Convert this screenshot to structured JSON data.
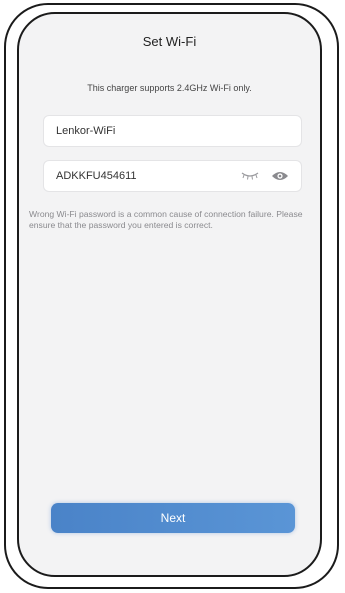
{
  "screen": {
    "title": "Set Wi-Fi",
    "notice": "This charger supports 2.4GHz Wi-Fi only."
  },
  "form": {
    "ssid_value": "Lenkor-WiFi",
    "password_value": "ADKKFU454611",
    "password_toggle_icon": "eye-closed-icon",
    "password_reveal_icon": "eye-icon",
    "hint": "Wrong Wi-Fi password is a common cause of connection failure. Please ensure that the password you entered is correct."
  },
  "actions": {
    "next_label": "Next"
  },
  "colors": {
    "accent": "#4a83c8",
    "background": "#f3f3f4",
    "hint_text": "#8a8a8e"
  }
}
